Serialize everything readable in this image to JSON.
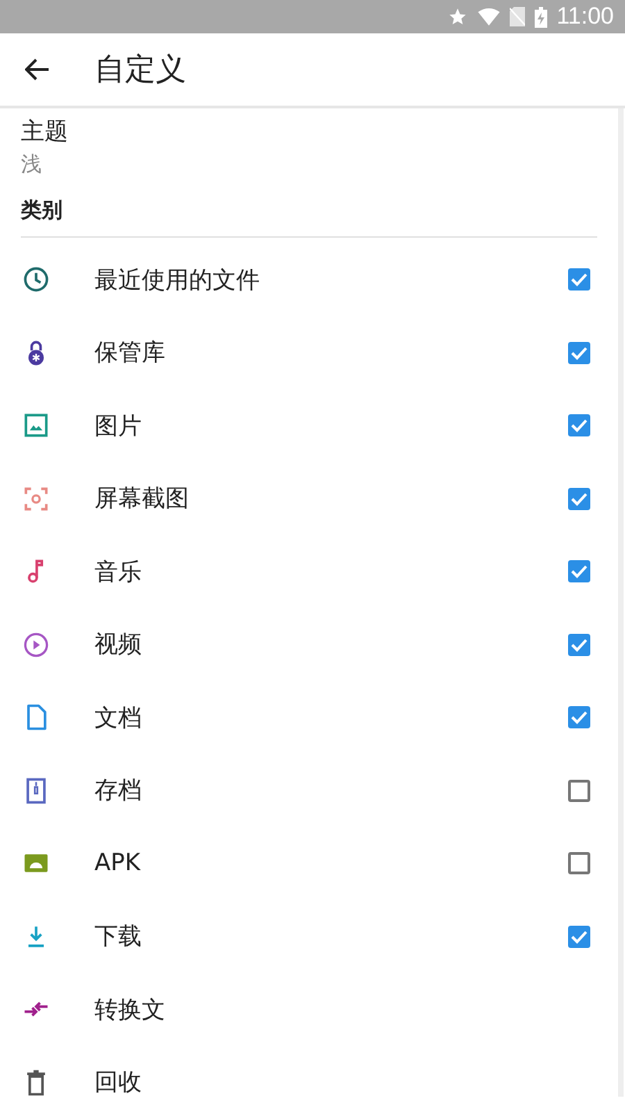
{
  "status_bar": {
    "time": "11:00"
  },
  "toolbar": {
    "title": "自定义"
  },
  "theme": {
    "label": "主题",
    "value": "浅"
  },
  "section": {
    "title": "类别"
  },
  "categories": [
    {
      "label": "最近使用的文件",
      "kind": "clock",
      "color": "#1f6b6b",
      "checked": true
    },
    {
      "label": "保管库",
      "kind": "lock",
      "color": "#4b3aa0",
      "checked": true
    },
    {
      "label": "图片",
      "kind": "image",
      "color": "#1a9a88",
      "checked": true
    },
    {
      "label": "屏幕截图",
      "kind": "screenshot",
      "color": "#e88a84",
      "checked": true
    },
    {
      "label": "音乐",
      "kind": "music",
      "color": "#d8406e",
      "checked": true
    },
    {
      "label": "视频",
      "kind": "video",
      "color": "#a656c4",
      "checked": true
    },
    {
      "label": "文档",
      "kind": "doc",
      "color": "#2a8fe0",
      "checked": true
    },
    {
      "label": "存档",
      "kind": "archive",
      "color": "#5a68c0",
      "checked": false
    },
    {
      "label": "APK",
      "kind": "apk",
      "color": "#7b9a1e",
      "checked": false
    },
    {
      "label": "下载",
      "kind": "download",
      "color": "#18a2c4",
      "checked": true
    },
    {
      "label": "转换文",
      "kind": "convert",
      "color": "#a0208c"
    },
    {
      "label": "回收",
      "kind": "trash",
      "color": "#555555"
    }
  ]
}
